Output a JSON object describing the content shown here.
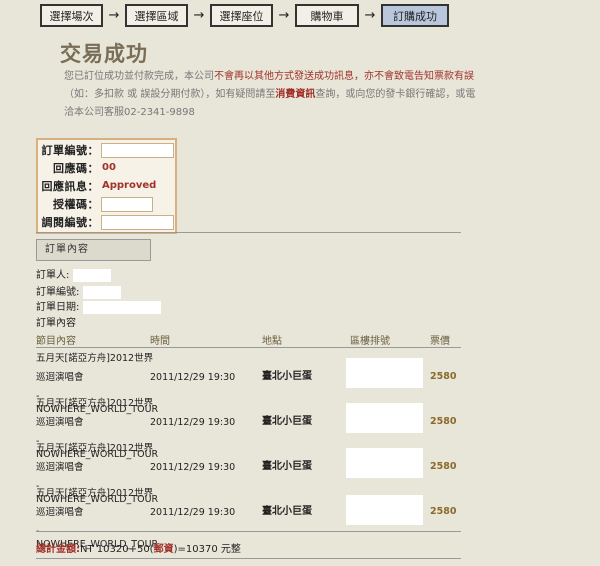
{
  "steps": [
    "選擇場次",
    "選擇區域",
    "選擇座位",
    "購物車",
    "訂購成功"
  ],
  "arrow": "→",
  "title": "交易成功",
  "message": {
    "p1": "您已訂位成功並付款完成，本公司",
    "p2": "不會再以其他方式發送成功訊息，亦不會致電告知票款有誤",
    "p3": "（如：多扣款 或 誤設分期付款），如有疑問請至",
    "p4": "消費資訊",
    "p5": "查詢，或向您的發卡銀行確認，或電洽本公司客服02-2341-9898"
  },
  "result": {
    "order_no_label": "訂單編號：",
    "response_code_label": "回應碼：",
    "response_code": "00",
    "response_msg_label": "回應訊息：",
    "response_msg": "Approved",
    "auth_code_label": "授權碼：",
    "ref_no_label": "調閱編號："
  },
  "section_title": "訂單內容",
  "info": {
    "orderer_label": "訂單人:",
    "order_no_label": "訂單編號:",
    "order_date_label": "訂單日期:",
    "content_label": "訂單內容"
  },
  "table": {
    "headers": [
      "節目內容",
      "時間",
      "地點",
      "區樓排號",
      "票價"
    ],
    "rows": [
      {
        "name1": "五月天[諾亞方舟]2012世界",
        "name2": "巡迴演唱會",
        "name3": "-NOWHERE_WORLD_TOUR",
        "time": "2011/12/29 19:30",
        "place": "臺北小巨蛋",
        "price": "2580"
      },
      {
        "name1": "五月天[諾亞方舟]2012世界",
        "name2": "巡迴演唱會",
        "name3": "-NOWHERE_WORLD_TOUR",
        "time": "2011/12/29 19:30",
        "place": "臺北小巨蛋",
        "price": "2580"
      },
      {
        "name1": "五月天[諾亞方舟]2012世界",
        "name2": "巡迴演唱會",
        "name3": "-NOWHERE_WORLD_TOUR",
        "time": "2011/12/29 19:30",
        "place": "臺北小巨蛋",
        "price": "2580"
      },
      {
        "name1": "五月天[諾亞方舟]2012世界",
        "name2": "巡迴演唱會",
        "name3": "-NOWHERE_WORLD_TOUR",
        "time": "2011/12/29 19:30",
        "place": "臺北小巨蛋",
        "price": "2580"
      }
    ]
  },
  "total": {
    "label": "總計金額:",
    "p1": "NT 10320+50(",
    "postage": "郵資",
    "p2": ")=10370 元整"
  }
}
